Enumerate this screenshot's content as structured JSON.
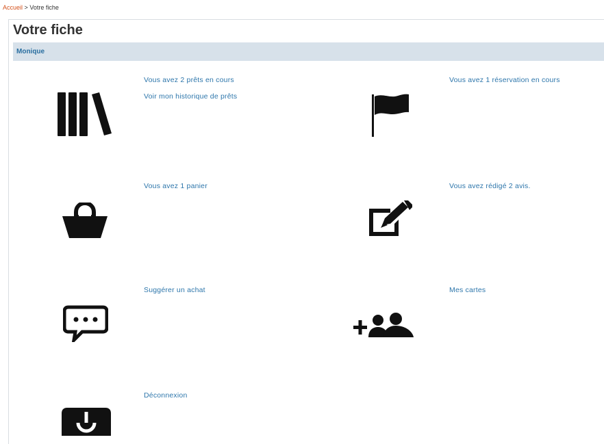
{
  "breadcrumb": {
    "home": "Accueil",
    "separator": ">",
    "current": "Votre fiche"
  },
  "page": {
    "title": "Votre fiche",
    "user_name": "Monique"
  },
  "sections": {
    "loans": {
      "icon": "books-icon",
      "line1": "Vous avez 2 prêts en cours",
      "line2": "Voir mon historique de prêts"
    },
    "reservations": {
      "icon": "flag-icon",
      "line1": "Vous avez 1 réservation en cours"
    },
    "basket": {
      "icon": "basket-icon",
      "line1": "Vous avez 1 panier"
    },
    "reviews": {
      "icon": "edit-icon",
      "line1": "Vous avez rédigé 2 avis."
    },
    "suggest": {
      "icon": "speech-bubble-icon",
      "line1": "Suggérer un achat"
    },
    "cards": {
      "icon": "add-users-icon",
      "line1": "Mes cartes"
    },
    "logout": {
      "icon": "power-icon",
      "line1": "Déconnexion"
    }
  }
}
